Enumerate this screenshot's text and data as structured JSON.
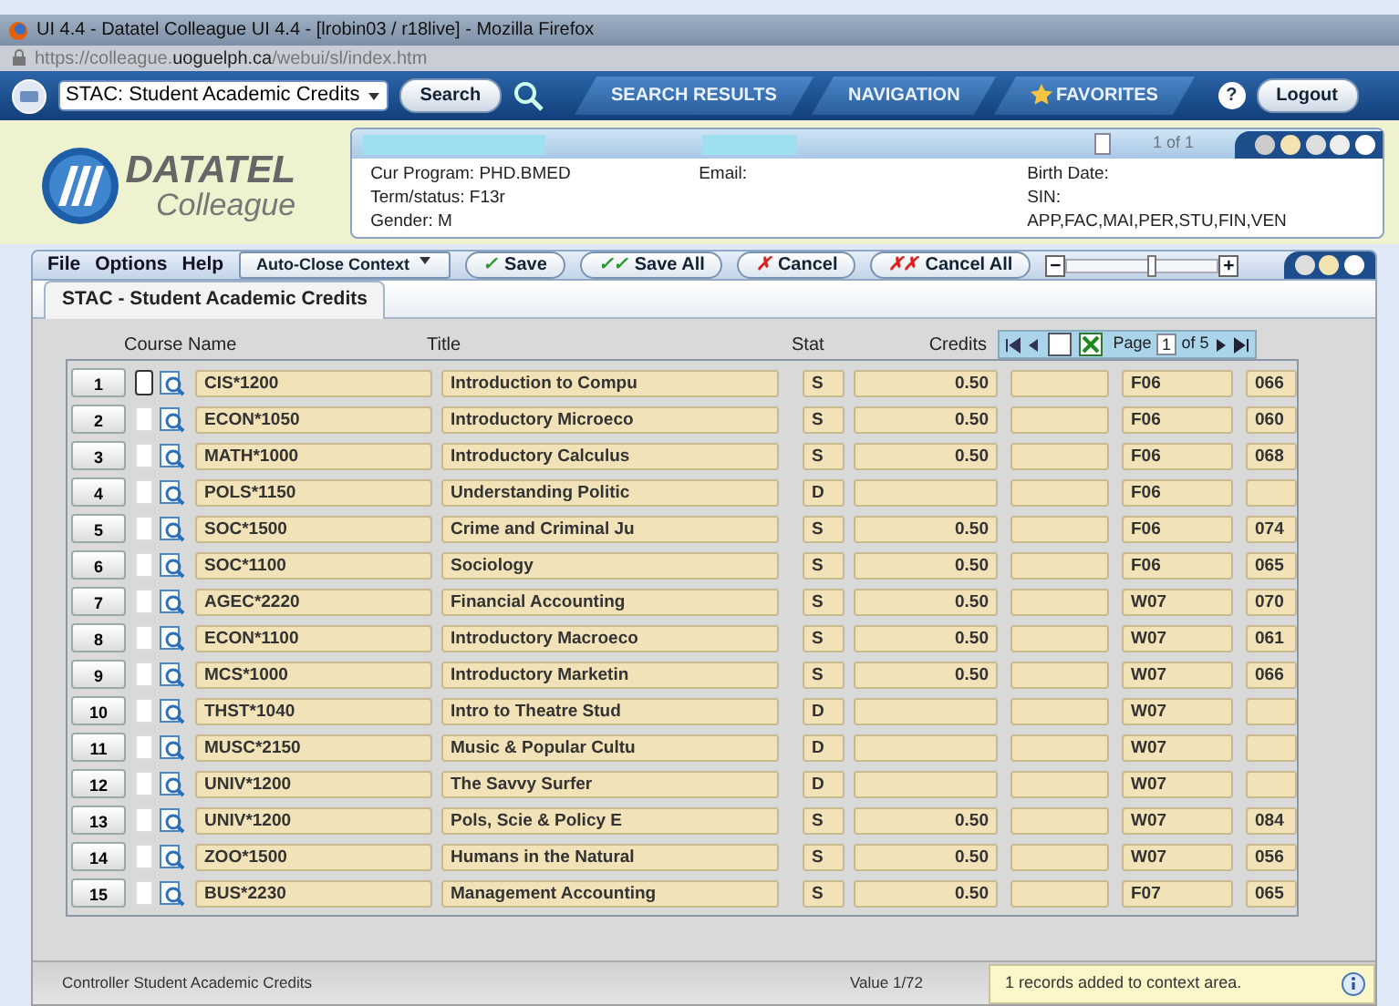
{
  "browser": {
    "title": "UI 4.4 - Datatel Colleague UI 4.4 - [lrobin03 / r18live] - Mozilla Firefox",
    "url_prefix": "https://colleague.",
    "url_domain": "uoguelph.ca",
    "url_path": "/webui/sl/index.htm"
  },
  "app_bar": {
    "form_select": "STAC: Student Academic Credits",
    "search_button": "Search",
    "nav_tabs": [
      {
        "label": "SEARCH RESULTS",
        "kind": "plain"
      },
      {
        "label": "NAVIGATION",
        "kind": "plain"
      },
      {
        "label": "FAVORITES",
        "kind": "star"
      }
    ],
    "help": "?",
    "logout": "Logout"
  },
  "logo": {
    "brand": "DATATEL",
    "product": "Colleague"
  },
  "context": {
    "pager": "1 of 1",
    "groups": [
      [
        "Cur Program: PHD.BMED",
        "Term/status: F13r",
        "Gender: M"
      ],
      [
        "Email:"
      ],
      [
        "Birth Date:",
        "SIN:",
        "APP,FAC,MAI,PER,STU,FIN,VEN"
      ]
    ]
  },
  "menu": [
    "File",
    "Options",
    "Help"
  ],
  "toolbar": {
    "context_select": "Auto-Close Context",
    "buttons": [
      {
        "label": "Save",
        "icon": "✓",
        "kind": "single-check"
      },
      {
        "label": "Save All",
        "icon": "✓✓",
        "kind": "double-check"
      },
      {
        "label": "Cancel",
        "icon": "✗",
        "kind": "single-cross"
      },
      {
        "label": "Cancel All",
        "icon": "✗✗",
        "kind": "double-cross"
      }
    ],
    "slider": {
      "minus": "−",
      "plus": "+",
      "level": 0.55
    }
  },
  "form_tab": {
    "label": "STAC - Student Academic Credits",
    "selected": true
  },
  "table": {
    "columns": [
      "Course Name",
      "Title",
      "Stat",
      "Credits"
    ],
    "pager": {
      "label": "Page",
      "page": "1",
      "of": "of 5"
    },
    "rows": [
      {
        "n": "1",
        "course": "CIS*1200",
        "title": "Introduction to Compu",
        "stat": "S",
        "credits": "0.50",
        "column_6": "F06",
        "column_7": "066",
        "focused": true
      },
      {
        "n": "2",
        "course": "ECON*1050",
        "title": "Introductory Microeco",
        "stat": "S",
        "credits": "0.50",
        "column_6": "F06",
        "column_7": "060",
        "focused": false
      },
      {
        "n": "3",
        "course": "MATH*1000",
        "title": "Introductory Calculus",
        "stat": "S",
        "credits": "0.50",
        "column_6": "F06",
        "column_7": "068",
        "focused": false
      },
      {
        "n": "4",
        "course": "POLS*1150",
        "title": "Understanding Politic",
        "stat": "D",
        "column_6": "F06",
        "focused": false
      },
      {
        "n": "5",
        "course": "SOC*1500",
        "title": "Crime and Criminal Ju",
        "stat": "S",
        "credits": "0.50",
        "column_6": "F06",
        "column_7": "074",
        "focused": false
      },
      {
        "n": "6",
        "course": "SOC*1100",
        "title": "Sociology",
        "stat": "S",
        "credits": "0.50",
        "column_6": "F06",
        "column_7": "065",
        "focused": false
      },
      {
        "n": "7",
        "course": "AGEC*2220",
        "title": "Financial Accounting",
        "stat": "S",
        "credits": "0.50",
        "column_6": "W07",
        "column_7": "070",
        "focused": false
      },
      {
        "n": "8",
        "course": "ECON*1100",
        "title": "Introductory Macroeco",
        "stat": "S",
        "credits": "0.50",
        "column_6": "W07",
        "column_7": "061",
        "focused": false
      },
      {
        "n": "9",
        "course": "MCS*1000",
        "title": "Introductory Marketin",
        "stat": "S",
        "credits": "0.50",
        "column_6": "W07",
        "column_7": "066",
        "focused": false
      },
      {
        "n": "10",
        "course": "THST*1040",
        "title": "Intro to Theatre Stud",
        "stat": "D",
        "column_6": "W07",
        "focused": false
      },
      {
        "n": "11",
        "course": "MUSC*2150",
        "title": "Music & Popular Cultu",
        "stat": "D",
        "column_6": "W07",
        "focused": false
      },
      {
        "n": "12",
        "course": "UNIV*1200",
        "title": "The Savvy Surfer",
        "stat": "D",
        "column_6": "W07",
        "focused": false
      },
      {
        "n": "13",
        "course": "UNIV*1200",
        "title": "Pols, Scie & Policy E",
        "stat": "S",
        "credits": "0.50",
        "column_6": "W07",
        "column_7": "084",
        "focused": false
      },
      {
        "n": "14",
        "course": "ZOO*1500",
        "title": "Humans in the Natural",
        "stat": "S",
        "credits": "0.50",
        "column_6": "W07",
        "column_7": "056",
        "focused": false
      },
      {
        "n": "15",
        "course": "BUS*2230",
        "title": "Management Accounting",
        "stat": "S",
        "credits": "0.50",
        "column_6": "F07",
        "column_7": "065",
        "focused": false
      }
    ]
  },
  "status_bar": {
    "left": "Controller Student Academic Credits",
    "middle": "Value 1/72",
    "message": "1 records added to context area."
  }
}
